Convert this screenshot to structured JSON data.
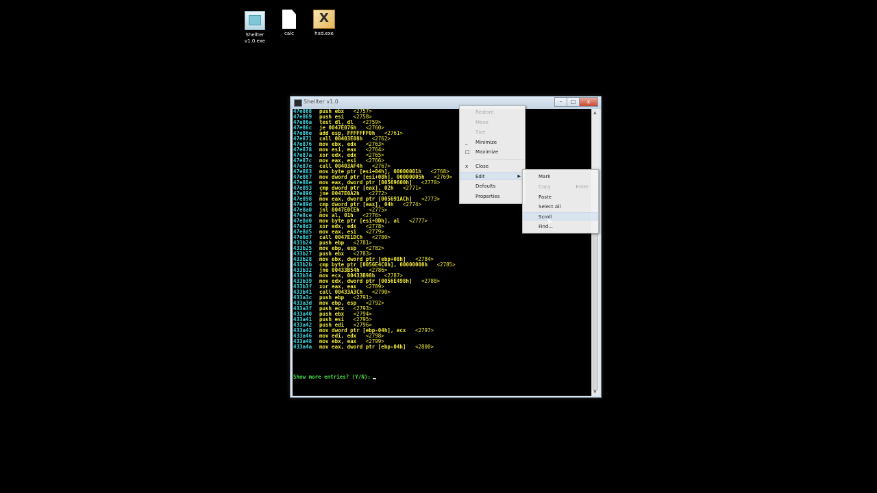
{
  "desktop": {
    "icons": [
      {
        "label": "Shellter\nv1.0.exe",
        "icon": "shellter-app-icon"
      },
      {
        "label": "calc",
        "icon": "blank-file-icon"
      },
      {
        "label": "hxd.exe",
        "icon": "hxd-app-icon"
      }
    ]
  },
  "window": {
    "title": "Shellter v1.0",
    "minimize_label": "–",
    "maximize_label": "□",
    "close_label": "x"
  },
  "console": {
    "lines": [
      {
        "addr": "47e868",
        "ins": "push ebx",
        "num": "<2757>"
      },
      {
        "addr": "47e869",
        "ins": "push esi",
        "num": "<2758>"
      },
      {
        "addr": "47e86a",
        "ins": "test dl, dl",
        "num": "<2759>"
      },
      {
        "addr": "47e86c",
        "ins": "je 0047E076h",
        "num": "<2760>"
      },
      {
        "addr": "47e86e",
        "ins": "add esp, FFFFFFF0h",
        "num": "<2761>"
      },
      {
        "addr": "47e871",
        "ins": "call 00403E08h",
        "num": "<2762>"
      },
      {
        "addr": "47e876",
        "ins": "mov ebx, edx",
        "num": "<2763>"
      },
      {
        "addr": "47e878",
        "ins": "mov esi, eax",
        "num": "<2764>"
      },
      {
        "addr": "47e87a",
        "ins": "xor edx, edx",
        "num": "<2765>"
      },
      {
        "addr": "47e87c",
        "ins": "mov eax, esi",
        "num": "<2766>"
      },
      {
        "addr": "47e87e",
        "ins": "call 00403AF4h",
        "num": "<2767>"
      },
      {
        "addr": "47e883",
        "ins": "mov byte ptr [esi+04h], 00000001h",
        "num": "<2768>"
      },
      {
        "addr": "47e887",
        "ins": "mov dword ptr [esi+08h], 00000005h",
        "num": "<2769>"
      },
      {
        "addr": "47e88e",
        "ins": "mov eax, dword ptr [00569600h]",
        "num": "<2770>"
      },
      {
        "addr": "47e893",
        "ins": "cmp dword ptr [eax], 02h",
        "num": "<2771>"
      },
      {
        "addr": "47e896",
        "ins": "jne 0047E0A2h",
        "num": "<2772>"
      },
      {
        "addr": "47e898",
        "ins": "mov eax, dword ptr [005691ACh]",
        "num": "<2773>"
      },
      {
        "addr": "47e89d",
        "ins": "cmp dword ptr [eax], 04h",
        "num": "<2774>"
      },
      {
        "addr": "47e8a0",
        "ins": "jnl 0047E0CEh",
        "num": "<2775>"
      },
      {
        "addr": "47e8ce",
        "ins": "mov al, 01h",
        "num": "<2776>"
      },
      {
        "addr": "47e8d0",
        "ins": "mov byte ptr [esi+0Dh], al",
        "num": "<2777>"
      },
      {
        "addr": "47e8d3",
        "ins": "xor edx, edx",
        "num": "<2778>"
      },
      {
        "addr": "47e8d5",
        "ins": "mov eax, esi",
        "num": "<2779>"
      },
      {
        "addr": "47e8d7",
        "ins": "call 0047E1DCh",
        "num": "<2780>"
      },
      {
        "addr": "433b24",
        "ins": "push ebp",
        "num": "<2781>"
      },
      {
        "addr": "433b25",
        "ins": "mov ebp, esp",
        "num": "<2782>"
      },
      {
        "addr": "433b27",
        "ins": "push ebx",
        "num": "<2783>"
      },
      {
        "addr": "433b28",
        "ins": "mov ebx, dword ptr [ebp+08h]",
        "num": "<2784>"
      },
      {
        "addr": "433b2b",
        "ins": "cmp byte ptr [0056E4C0h], 00000000h",
        "num": "<2785>"
      },
      {
        "addr": "433b32",
        "ins": "jne 00433B54h",
        "num": "<2786>"
      },
      {
        "addr": "433b34",
        "ins": "mov ecx, 00433B98h",
        "num": "<2787>"
      },
      {
        "addr": "433b39",
        "ins": "mov edx, dword ptr [0056E498h]",
        "num": "<2788>"
      },
      {
        "addr": "433b3f",
        "ins": "xor eax, eax",
        "num": "<2789>"
      },
      {
        "addr": "433b41",
        "ins": "call 00433A3Ch",
        "num": "<2790>"
      },
      {
        "addr": "433a3c",
        "ins": "push ebp",
        "num": "<2791>"
      },
      {
        "addr": "433a3d",
        "ins": "mov ebp, esp",
        "num": "<2792>"
      },
      {
        "addr": "433a3f",
        "ins": "push ecx",
        "num": "<2793>"
      },
      {
        "addr": "433a40",
        "ins": "push ebx",
        "num": "<2794>"
      },
      {
        "addr": "433a41",
        "ins": "push esi",
        "num": "<2795>"
      },
      {
        "addr": "433a42",
        "ins": "push edi",
        "num": "<2796>"
      },
      {
        "addr": "433a43",
        "ins": "mov dword ptr [ebp-04h], ecx",
        "num": "<2797>"
      },
      {
        "addr": "433a46",
        "ins": "mov edi, edx",
        "num": "<2798>"
      },
      {
        "addr": "433a48",
        "ins": "mov ebx, eax",
        "num": "<2799>"
      },
      {
        "addr": "433a4a",
        "ins": "mov eax, dword ptr [ebp-04h]",
        "num": "<2800>"
      }
    ],
    "prompt": "Show more entries? (Y/N):"
  },
  "system_menu": {
    "items": [
      {
        "label": "Restore",
        "disabled": true,
        "glyph": ""
      },
      {
        "label": "Move",
        "disabled": true,
        "glyph": ""
      },
      {
        "label": "Size",
        "disabled": true,
        "glyph": ""
      },
      {
        "label": "Minimize",
        "disabled": false,
        "glyph": "_"
      },
      {
        "label": "Maximize",
        "disabled": false,
        "glyph": "□"
      },
      {
        "label": "Close",
        "disabled": false,
        "glyph": "x",
        "bold": true
      },
      {
        "label": "Edit",
        "disabled": false,
        "glyph": "",
        "submenu": true,
        "hover": true
      },
      {
        "label": "Defaults",
        "disabled": false,
        "glyph": ""
      },
      {
        "label": "Properties",
        "disabled": false,
        "glyph": ""
      }
    ]
  },
  "edit_menu": {
    "items": [
      {
        "label": "Mark",
        "disabled": false,
        "hover": false
      },
      {
        "label": "Copy",
        "disabled": true,
        "hover": false,
        "shortcut": "Enter"
      },
      {
        "label": "Paste",
        "disabled": false,
        "hover": false
      },
      {
        "label": "Select All",
        "disabled": false,
        "hover": false
      },
      {
        "label": "Scroll",
        "disabled": false,
        "hover": true
      },
      {
        "label": "Find...",
        "disabled": false,
        "hover": false
      }
    ]
  }
}
